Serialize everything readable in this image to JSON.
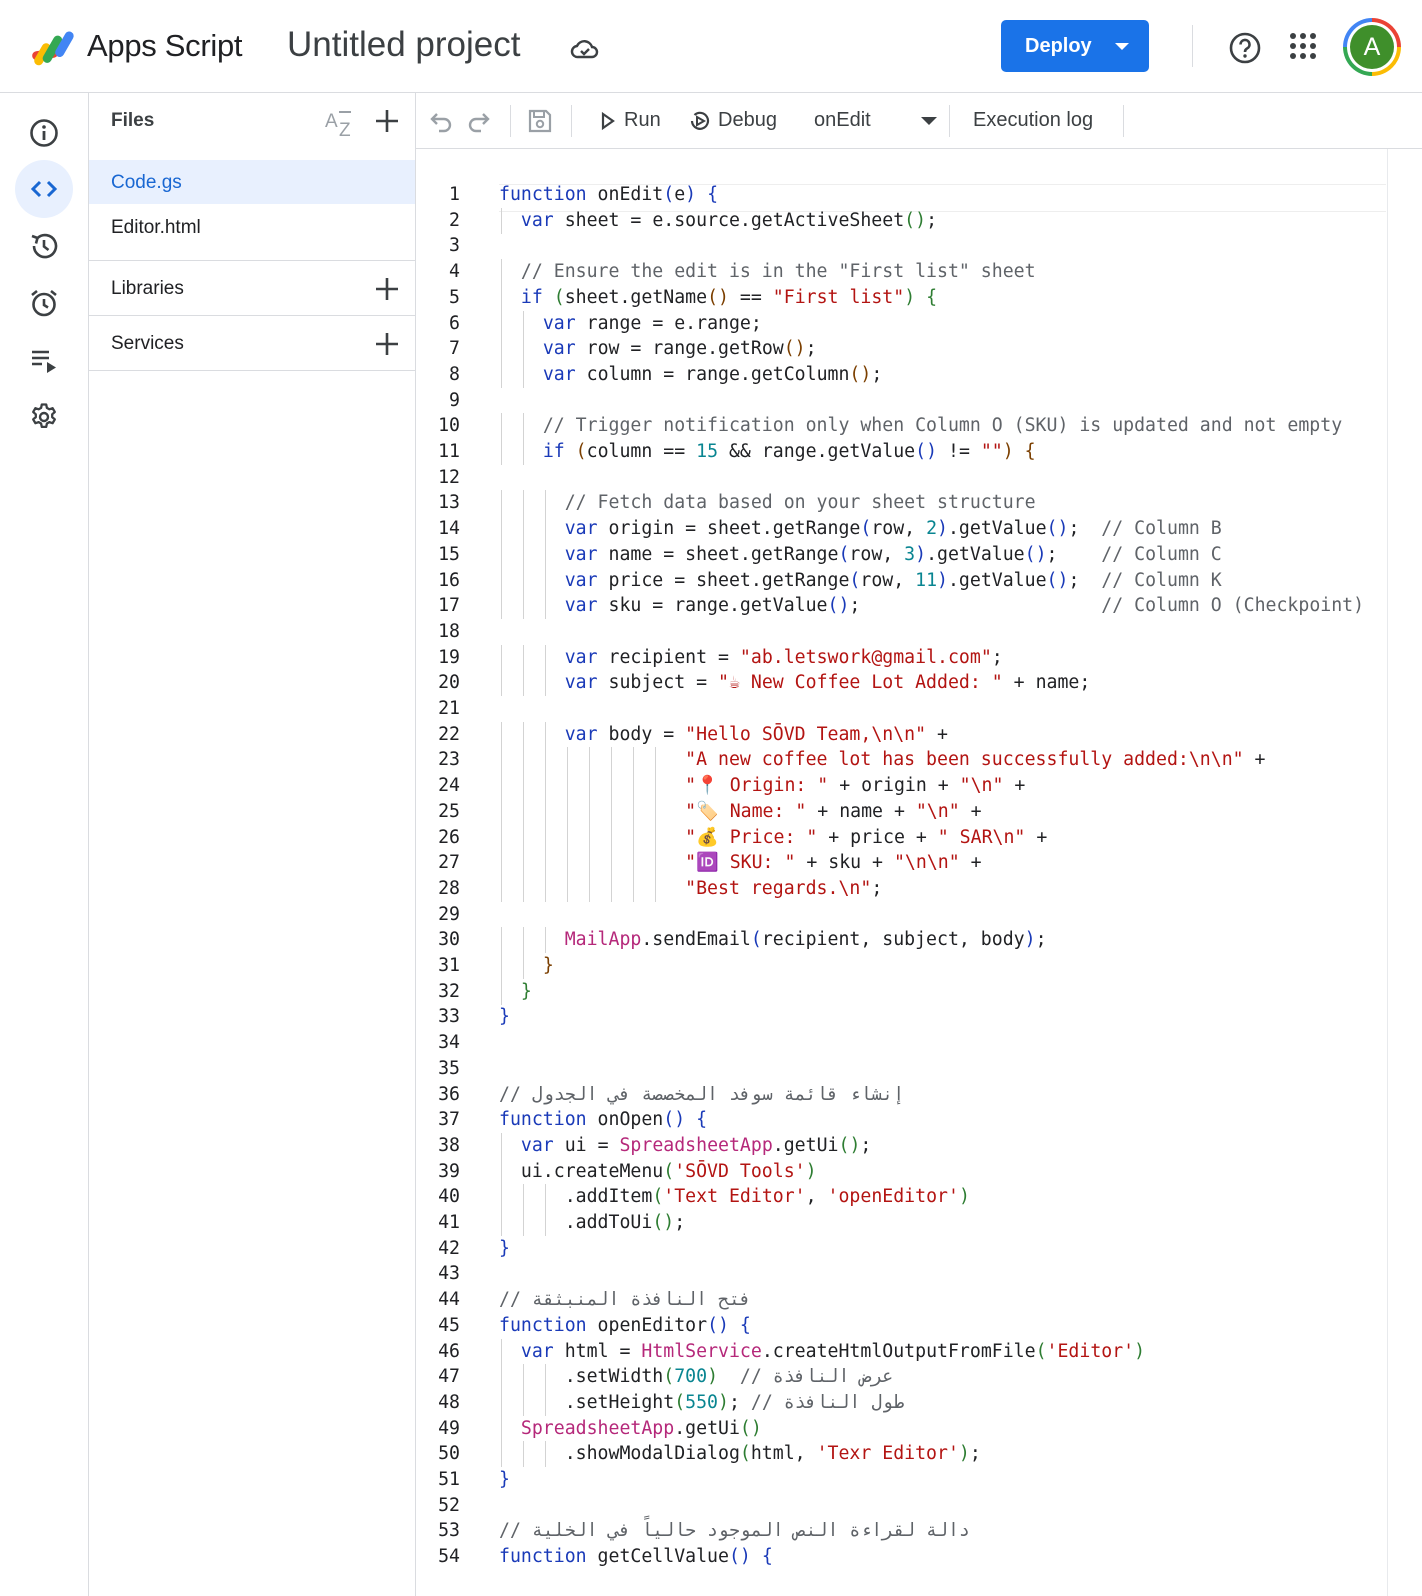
{
  "header": {
    "app_name": "Apps Script",
    "project_title": "Untitled project",
    "deploy_label": "Deploy",
    "avatar_initial": "A",
    "brand_color": "#1a73e8"
  },
  "rail": {
    "items": [
      {
        "name": "overview",
        "icon": "info-icon"
      },
      {
        "name": "editor",
        "icon": "code-icon",
        "active": true
      },
      {
        "name": "project-history",
        "icon": "history-icon"
      },
      {
        "name": "triggers",
        "icon": "alarm-clock-icon"
      },
      {
        "name": "executions",
        "icon": "executions-list-icon"
      },
      {
        "name": "project-settings",
        "icon": "gear-icon"
      }
    ]
  },
  "files_panel": {
    "files_label": "Files",
    "files": [
      {
        "name": "Code.gs",
        "active": true
      },
      {
        "name": "Editor.html",
        "active": false
      }
    ],
    "libraries_label": "Libraries",
    "services_label": "Services"
  },
  "toolbar": {
    "run_label": "Run",
    "debug_label": "Debug",
    "function_select": "onEdit",
    "execution_log_label": "Execution log"
  },
  "code": {
    "language": "javascript",
    "lines": [
      "function onEdit(e) {",
      "  var sheet = e.source.getActiveSheet();",
      "",
      "  // Ensure the edit is in the \"First list\" sheet",
      "  if (sheet.getName() == \"First list\") {",
      "    var range = e.range;",
      "    var row = range.getRow();",
      "    var column = range.getColumn();",
      "",
      "    // Trigger notification only when Column O (SKU) is updated and not empty",
      "    if (column == 15 && range.getValue() != \"\") {",
      "",
      "      // Fetch data based on your sheet structure",
      "      var origin = sheet.getRange(row, 2).getValue();  // Column B",
      "      var name = sheet.getRange(row, 3).getValue();    // Column C",
      "      var price = sheet.getRange(row, 11).getValue();  // Column K",
      "      var sku = range.getValue();                      // Column O (Checkpoint)",
      "",
      "      var recipient = \"ab.letswork@gmail.com\";",
      "      var subject = \"☕ New Coffee Lot Added: \" + name;",
      "",
      "      var body = \"Hello SŌVD Team,\\n\\n\" +",
      "                 \"A new coffee lot has been successfully added:\\n\\n\" +",
      "                 \"📍 Origin: \" + origin + \"\\n\" +",
      "                 \"🏷️ Name: \" + name + \"\\n\" +",
      "                 \"💰 Price: \" + price + \" SAR\\n\" +",
      "                 \"🆔 SKU: \" + sku + \"\\n\\n\" +",
      "                 \"Best regards.\\n\";",
      "",
      "      MailApp.sendEmail(recipient, subject, body);",
      "    }",
      "  }",
      "}",
      "",
      "",
      "// إنشاء قائمة سوفد المخصصة في الجدول",
      "function onOpen() {",
      "  var ui = SpreadsheetApp.getUi();",
      "  ui.createMenu('SŌVD Tools')",
      "      .addItem('Text Editor', 'openEditor')",
      "      .addToUi();",
      "}",
      "",
      "// فتح النافذة المنبثقة",
      "function openEditor() {",
      "  var html = HtmlService.createHtmlOutputFromFile('Editor')",
      "      .setWidth(700)  // عرض النافذة",
      "      .setHeight(550); // طول النافذة",
      "  SpreadsheetApp.getUi()",
      "      .showModalDialog(html, 'Texr Editor');",
      "}",
      "",
      "// دالة لقراءة النص الموجود حالياً في الخلية",
      "function getCellValue() {"
    ]
  }
}
